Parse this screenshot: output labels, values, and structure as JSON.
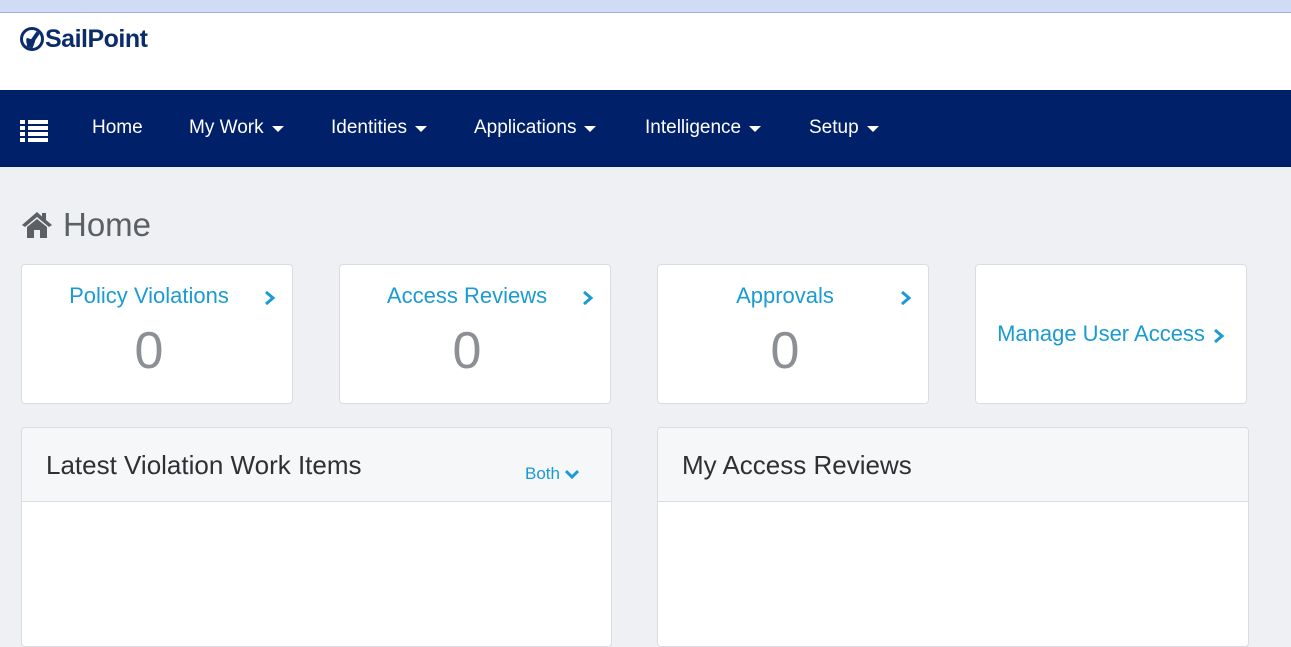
{
  "brand": {
    "name": "SailPoint",
    "color": "#0b2c6b"
  },
  "nav": {
    "menu_icon": "list-icon",
    "items": [
      {
        "label": "Home",
        "has_dropdown": false
      },
      {
        "label": "My Work",
        "has_dropdown": true
      },
      {
        "label": "Identities",
        "has_dropdown": true
      },
      {
        "label": "Applications",
        "has_dropdown": true
      },
      {
        "label": "Intelligence",
        "has_dropdown": true
      },
      {
        "label": "Setup",
        "has_dropdown": true
      }
    ],
    "bg_color": "#00206a"
  },
  "page": {
    "title": "Home",
    "icon": "home-icon"
  },
  "cards": [
    {
      "title": "Policy Violations",
      "count": "0"
    },
    {
      "title": "Access Reviews",
      "count": "0"
    },
    {
      "title": "Approvals",
      "count": "0"
    },
    {
      "title": "Manage User Access"
    }
  ],
  "panels": {
    "violations": {
      "title": "Latest Violation Work Items",
      "filter_label": "Both"
    },
    "reviews": {
      "title": "My Access Reviews"
    }
  },
  "colors": {
    "accent": "#1b9bd1",
    "background": "#eef0f3",
    "count": "#8c8f94"
  }
}
